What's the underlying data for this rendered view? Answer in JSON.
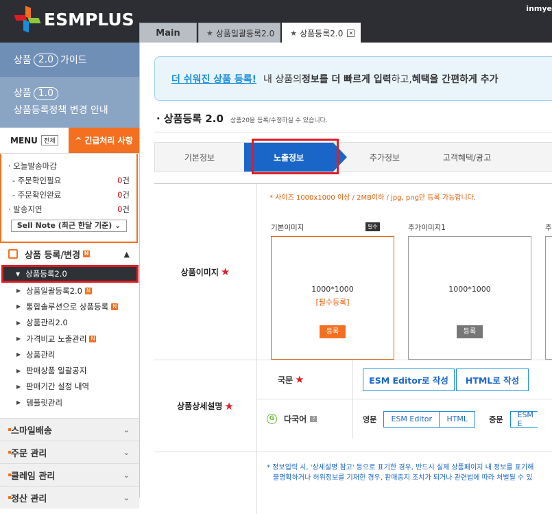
{
  "header": {
    "logo_text": "ESMPLUS",
    "user": "inmye",
    "logo_colors": [
      "#f37021",
      "#e01c24",
      "#8dc63f",
      "#1a8fd9"
    ]
  },
  "tabs": [
    {
      "label": "Main"
    },
    {
      "label": "상품일괄등록2.0"
    },
    {
      "label": "상품등록2.0"
    }
  ],
  "sidebar": {
    "guide1": {
      "pre": "상품",
      "ver": "2.0",
      "post": "가이드"
    },
    "guide2": {
      "pre": "상품",
      "ver": "1.0",
      "line2": "상품등록정책 변경 안내"
    },
    "menu": "MENU",
    "menu_all": "전체",
    "urgent": "긴급처리 사항",
    "status": [
      {
        "label": "· 오늘발송마감",
        "count": ""
      },
      {
        "label": "- 주문확인필요",
        "count": "0",
        "unit": "건"
      },
      {
        "label": "- 주문확인완료",
        "count": "0",
        "unit": "건"
      },
      {
        "label": "· 발송지연",
        "count": "0",
        "unit": "건"
      }
    ],
    "sell_note": "Sell Note (최근 한달 기준)",
    "section": "상품 등록/변경",
    "items": [
      {
        "label": "상품등록2.0"
      },
      {
        "label": "상품일괄등록2.0"
      },
      {
        "label": "통합솔루션으로 상품등록"
      },
      {
        "label": "상품관리2.0"
      },
      {
        "label": "가격비교 노출관리"
      },
      {
        "label": "상품관리"
      },
      {
        "label": "판매상품 일괄공지"
      },
      {
        "label": "판매기간 설정 내역"
      },
      {
        "label": "템플릿관리"
      }
    ],
    "groups": [
      {
        "label": "스마일배송"
      },
      {
        "label": "주문 관리"
      },
      {
        "label": "클레임 관리"
      },
      {
        "label": "정산 관리"
      }
    ]
  },
  "banner": {
    "highlight": "더 쉬워진 상품 등록!",
    "t1": "내 상품의 ",
    "b1": "정보를 더 빠르게 입력",
    "t2": "하고, ",
    "b2": "혜택을 간편하게 추가"
  },
  "page": {
    "title": "상품등록 2.0",
    "sub": "상품20을 등록/수정하실 수 있습니다."
  },
  "steps": [
    "기본정보",
    "노출정보",
    "추가정보",
    "고객혜택/광고"
  ],
  "image_section": {
    "label": "상품이미지",
    "note": "* 사이즈 1000x1000 이상 / 2MB이하 / jpg, png만 등록 가능합니다.",
    "main_label": "기본이미지",
    "required": "필수",
    "add_label": "추가이미지1",
    "add_label2": "추",
    "dim": "1000*1000",
    "req_text": "[필수등록]",
    "btn": "등록"
  },
  "detail_section": {
    "label": "상품상세설명",
    "domestic": "국문",
    "editor_btn": "ESM Editor로 작성",
    "html_btn": "HTML로 작성",
    "multi": "다국어",
    "english": "영문",
    "esm_editor": "ESM Editor",
    "html": "HTML",
    "chinese": "중문",
    "esm_short": "ESM E"
  },
  "info": {
    "l1": "* 정보입력 시, '상세설명 참고' 등으로 표기한 경우, 반드시 실제 상품페이지 내 정보를 표기해",
    "l2": "불명확하거나 허위정보를 기재한 경우, 판매중지 조치가 되거나 관련법에 따라 처벌될 수 있"
  }
}
